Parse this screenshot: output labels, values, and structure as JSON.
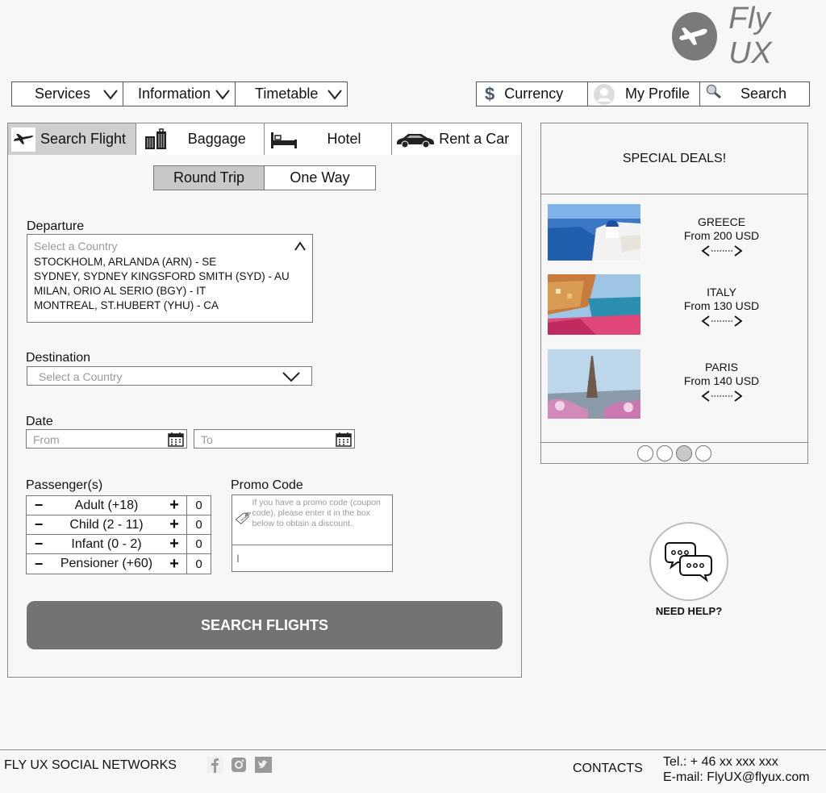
{
  "brand": {
    "name": "Fly UX"
  },
  "nav": {
    "left": [
      {
        "label": "Services"
      },
      {
        "label": "Information"
      },
      {
        "label": "Timetable"
      }
    ],
    "currency": "Currency",
    "profile": "My Profile",
    "search": "Search"
  },
  "tabs": [
    {
      "label": "Search Flight",
      "icon": "airplane-icon",
      "active": true
    },
    {
      "label": "Baggage",
      "icon": "luggage-icon"
    },
    {
      "label": "Hotel",
      "icon": "bed-icon"
    },
    {
      "label": "Rent a Car",
      "icon": "car-icon"
    }
  ],
  "trip": {
    "round": "Round Trip",
    "oneway": "One Way"
  },
  "departure": {
    "label": "Departure",
    "placeholder": "Select a Country",
    "options": [
      "STOCKHOLM, ARLANDA (ARN) - SE",
      "SYDNEY, SYDNEY KINGSFORD SMITH (SYD) - AU",
      "MILAN, ORIO AL SERIO (BGY) - IT",
      "MONTREAL, ST.HUBERT (YHU) - CA"
    ]
  },
  "destination": {
    "label": "Destination",
    "placeholder": "Select a Country"
  },
  "date": {
    "label": "Date",
    "from": "From",
    "to": "To"
  },
  "passengers": {
    "label": "Passenger(s)",
    "rows": [
      {
        "name": "Adult (+18)",
        "count": "0"
      },
      {
        "name": "Child (2 - 11)",
        "count": "0"
      },
      {
        "name": "Infant (0 - 2)",
        "count": "0"
      },
      {
        "name": "Pensioner (+60)",
        "count": "0"
      }
    ]
  },
  "promo": {
    "label": "Promo Code",
    "hint": "If you have a promo code (coupon code), please enter it in the box below to obtain a discount.",
    "tag_text": "PROMO CODE"
  },
  "search_button": "SEARCH FLIGHTS",
  "deals": {
    "title": "SPECIAL DEALS!",
    "items": [
      {
        "name": "GREECE",
        "price": "From 200 USD"
      },
      {
        "name": "ITALY",
        "price": "From 130 USD"
      },
      {
        "name": "PARIS",
        "price": "From 140 USD"
      }
    ],
    "active_dot": 2
  },
  "help": {
    "label": "NEED HELP?"
  },
  "footer": {
    "social": "FLY UX SOCIAL NETWORKS",
    "contacts": "CONTACTS",
    "tel": "Tel.: + 46 xx xxx xxx",
    "email": "E-mail: FlyUX@flyux.com"
  },
  "colors": {
    "accent_gray": "#737373",
    "active_tab": "#cfcfcf"
  }
}
